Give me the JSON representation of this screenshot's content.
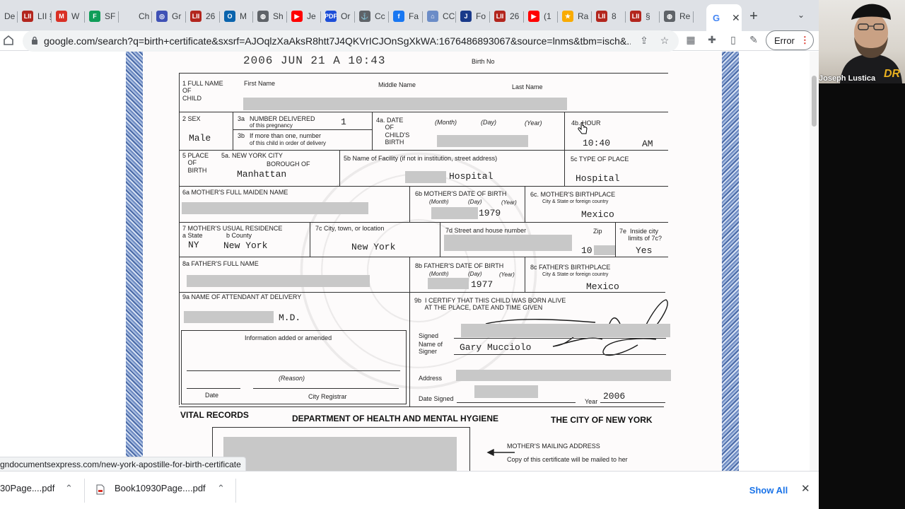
{
  "tabs": [
    {
      "title": "De",
      "color": "#1a73e8",
      "glyph": ""
    },
    {
      "title": "LII §",
      "color": "#b3261e",
      "glyph": "LII"
    },
    {
      "title": "W",
      "color": "#d93025",
      "glyph": "M"
    },
    {
      "title": "SF",
      "color": "#0f9d58",
      "glyph": "F"
    },
    {
      "title": "Ch",
      "color": "#ffffff",
      "glyph": ""
    },
    {
      "title": "Gr",
      "color": "#3f51b5",
      "glyph": "◎"
    },
    {
      "title": "26",
      "color": "#b3261e",
      "glyph": "LII"
    },
    {
      "title": "M",
      "color": "#0a64ad",
      "glyph": "O"
    },
    {
      "title": "Sh",
      "color": "#5f6368",
      "glyph": "◍"
    },
    {
      "title": "Je",
      "color": "#ff0000",
      "glyph": "▶"
    },
    {
      "title": "Or",
      "color": "#1d4ed8",
      "glyph": "PDF"
    },
    {
      "title": "Cc",
      "color": "#5f6368",
      "glyph": "⚓"
    },
    {
      "title": "Fa",
      "color": "#1877f2",
      "glyph": "f"
    },
    {
      "title": "CC",
      "color": "#6b8cc7",
      "glyph": "⌂"
    },
    {
      "title": "Fo",
      "color": "#1a3a8a",
      "glyph": "J"
    },
    {
      "title": "26",
      "color": "#b3261e",
      "glyph": "LII"
    },
    {
      "title": "(1",
      "color": "#ff0000",
      "glyph": "▶"
    },
    {
      "title": "Ra",
      "color": "#f9ab00",
      "glyph": "★"
    },
    {
      "title": "8",
      "color": "#b3261e",
      "glyph": "LII"
    },
    {
      "title": "§",
      "color": "#b3261e",
      "glyph": "LII"
    },
    {
      "title": "Re",
      "color": "#5f6368",
      "glyph": "◍"
    },
    {
      "title": "",
      "color": "#4285f4",
      "glyph": "G",
      "active": true
    }
  ],
  "toolbar": {
    "url": "google.com/search?q=birth+certificate&sxsrf=AJOqlzXaAksR8htt7J4QKVrICJOnSgXkWA:1676486893067&source=lnms&tbm=isch&...",
    "error_label": "Error",
    "menu_dots": "⋮"
  },
  "certificate": {
    "stamp": "2006 JUN 21  A 10:43",
    "birth_no_label": "Birth No",
    "f1_label": "1 FULL NAME\nOF\nCHILD",
    "first_name_label": "First Name",
    "middle_name_label": "Middle Name",
    "last_name_label": "Last Name",
    "f2_label": "2 SEX",
    "sex_value": "Male",
    "f3a_num": "3a",
    "f3a_label": "NUMBER DELIVERED",
    "f3a_sub": "of this pregnancy",
    "f3a_value": "1",
    "f3b_num": "3b",
    "f3b_label": "If more than one, number",
    "f3b_sub": "of this child in order of delivery",
    "f4a_label": "4a. DATE\n     OF\n     CHILD'S\n     BIRTH",
    "month_label": "(Month)",
    "day_label": "(Day)",
    "year_label": "(Year)",
    "f4b_label": "4b. HOUR",
    "hour_value": "10:40",
    "ampm_value": "AM",
    "f5_label": "5 PLACE\n   OF\n   BIRTH",
    "f5a_label": "5a.     NEW YORK CITY",
    "borough_label": "BOROUGH OF",
    "borough_value": "Manhattan",
    "f5b_label": "5b  Name of Facility (if not in institution, street address)",
    "facility_value": "Hospital",
    "f5c_label": "5c  TYPE OF PLACE",
    "place_type_value": "Hospital",
    "f6a_label": "6a  MOTHER'S FULL MAIDEN NAME",
    "f6b_label": "6b  MOTHER'S DATE OF BIRTH",
    "mother_year": "1979",
    "f6c_label": "6c.  MOTHER'S BIRTHPLACE",
    "city_state_label": "City & State or foreign country",
    "mother_birthplace": "Mexico",
    "f7_label": "7  MOTHER'S USUAL RESIDENCE",
    "f7a_label": "a  State",
    "f7b_label": "b  County",
    "state_value": "NY",
    "county_value": "New York",
    "f7c_label": "7c  City, town, or location",
    "city_value": "New York",
    "f7d_label": "7d  Street and house number",
    "zip_label": "Zip",
    "zip_value": "10",
    "f7e_label": "7e  Inside city\n     limits of 7c?",
    "inside_value": "Yes",
    "f8a_label": "8a  FATHER'S FULL NAME",
    "f8b_label": "8b  FATHER'S DATE OF BIRTH",
    "father_year": "1977",
    "f8c_label": "8c  FATHER'S BIRTHPLACE",
    "father_birthplace": "Mexico",
    "f9a_label": "9a  NAME OF ATTENDANT AT DELIVERY",
    "md_value": "M.D.",
    "f9b_label": "9b  I CERTIFY THAT THIS CHILD WAS BORN ALIVE\n      AT THE PLACE, DATE AND TIME GIVEN",
    "amended_label": "Information added or amended",
    "reason_label": "(Reason)",
    "date_label": "Date",
    "registrar_label": "City Registrar",
    "signed_label": "Signed",
    "signer_label": "Name of\nSigner",
    "signer_value": "Gary Mucciolo",
    "address_label": "Address",
    "date_signed_label": "Date Signed",
    "year_word": "Year",
    "signed_year": "2006",
    "vital_records": "VITAL RECORDS",
    "dept": "DEPARTMENT OF HEALTH AND MENTAL HYGIENE",
    "city": "THE CITY OF NEW YORK",
    "mailing_label": "MOTHER'S MAILING ADDRESS",
    "mailing_sub": "Copy of this certificate will be mailed to her"
  },
  "status_link": "gndocumentsexpress.com/new-york-apostille-for-birth-certificate",
  "downloads": {
    "item1": "30Page....pdf",
    "item2": "Book10930Page....pdf",
    "show_all": "Show All"
  },
  "webcam": {
    "name": "Joseph Lustica",
    "logo": "DR"
  }
}
